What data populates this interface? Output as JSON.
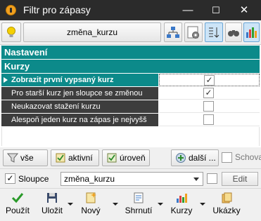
{
  "window": {
    "title": "Filtr pro zápasy",
    "minimize": "—",
    "maximize": "☐",
    "close": "✕"
  },
  "toolbar": {
    "combo_label": "změna_kurzu"
  },
  "sections": {
    "settings": "Nastavení",
    "odds": "Kurzy"
  },
  "rows": [
    {
      "label": "Zobrazit první vypsaný kurz",
      "checked": true,
      "mark": "✓"
    },
    {
      "label": "Pro starší kurz jen sloupce se změnou",
      "checked": true,
      "mark": "✓"
    },
    {
      "label": "Neukazovat stažení kurzu",
      "checked": false,
      "mark": ""
    },
    {
      "label": "Alespoň jeden kurz na zápas je nejvyšš",
      "checked": false,
      "mark": ""
    }
  ],
  "filter_buttons": {
    "all": "vše",
    "active": "aktivní",
    "level": "úroveň",
    "more": "další ...",
    "hide_label": "Schova"
  },
  "columns": {
    "label": "Sloupce",
    "checked_mark": "✓",
    "selected": "změna_kurzu",
    "edit": "Edit"
  },
  "bottom": {
    "use": "Použít",
    "save": "Uložit",
    "new": "Nový",
    "summary": "Shrnutí",
    "odds": "Kurzy",
    "examples": "Ukázky"
  },
  "colors": {
    "accent": "#0c8a8a",
    "titlebar": "#2b2b2b",
    "row_bg": "#3d3d3d"
  }
}
